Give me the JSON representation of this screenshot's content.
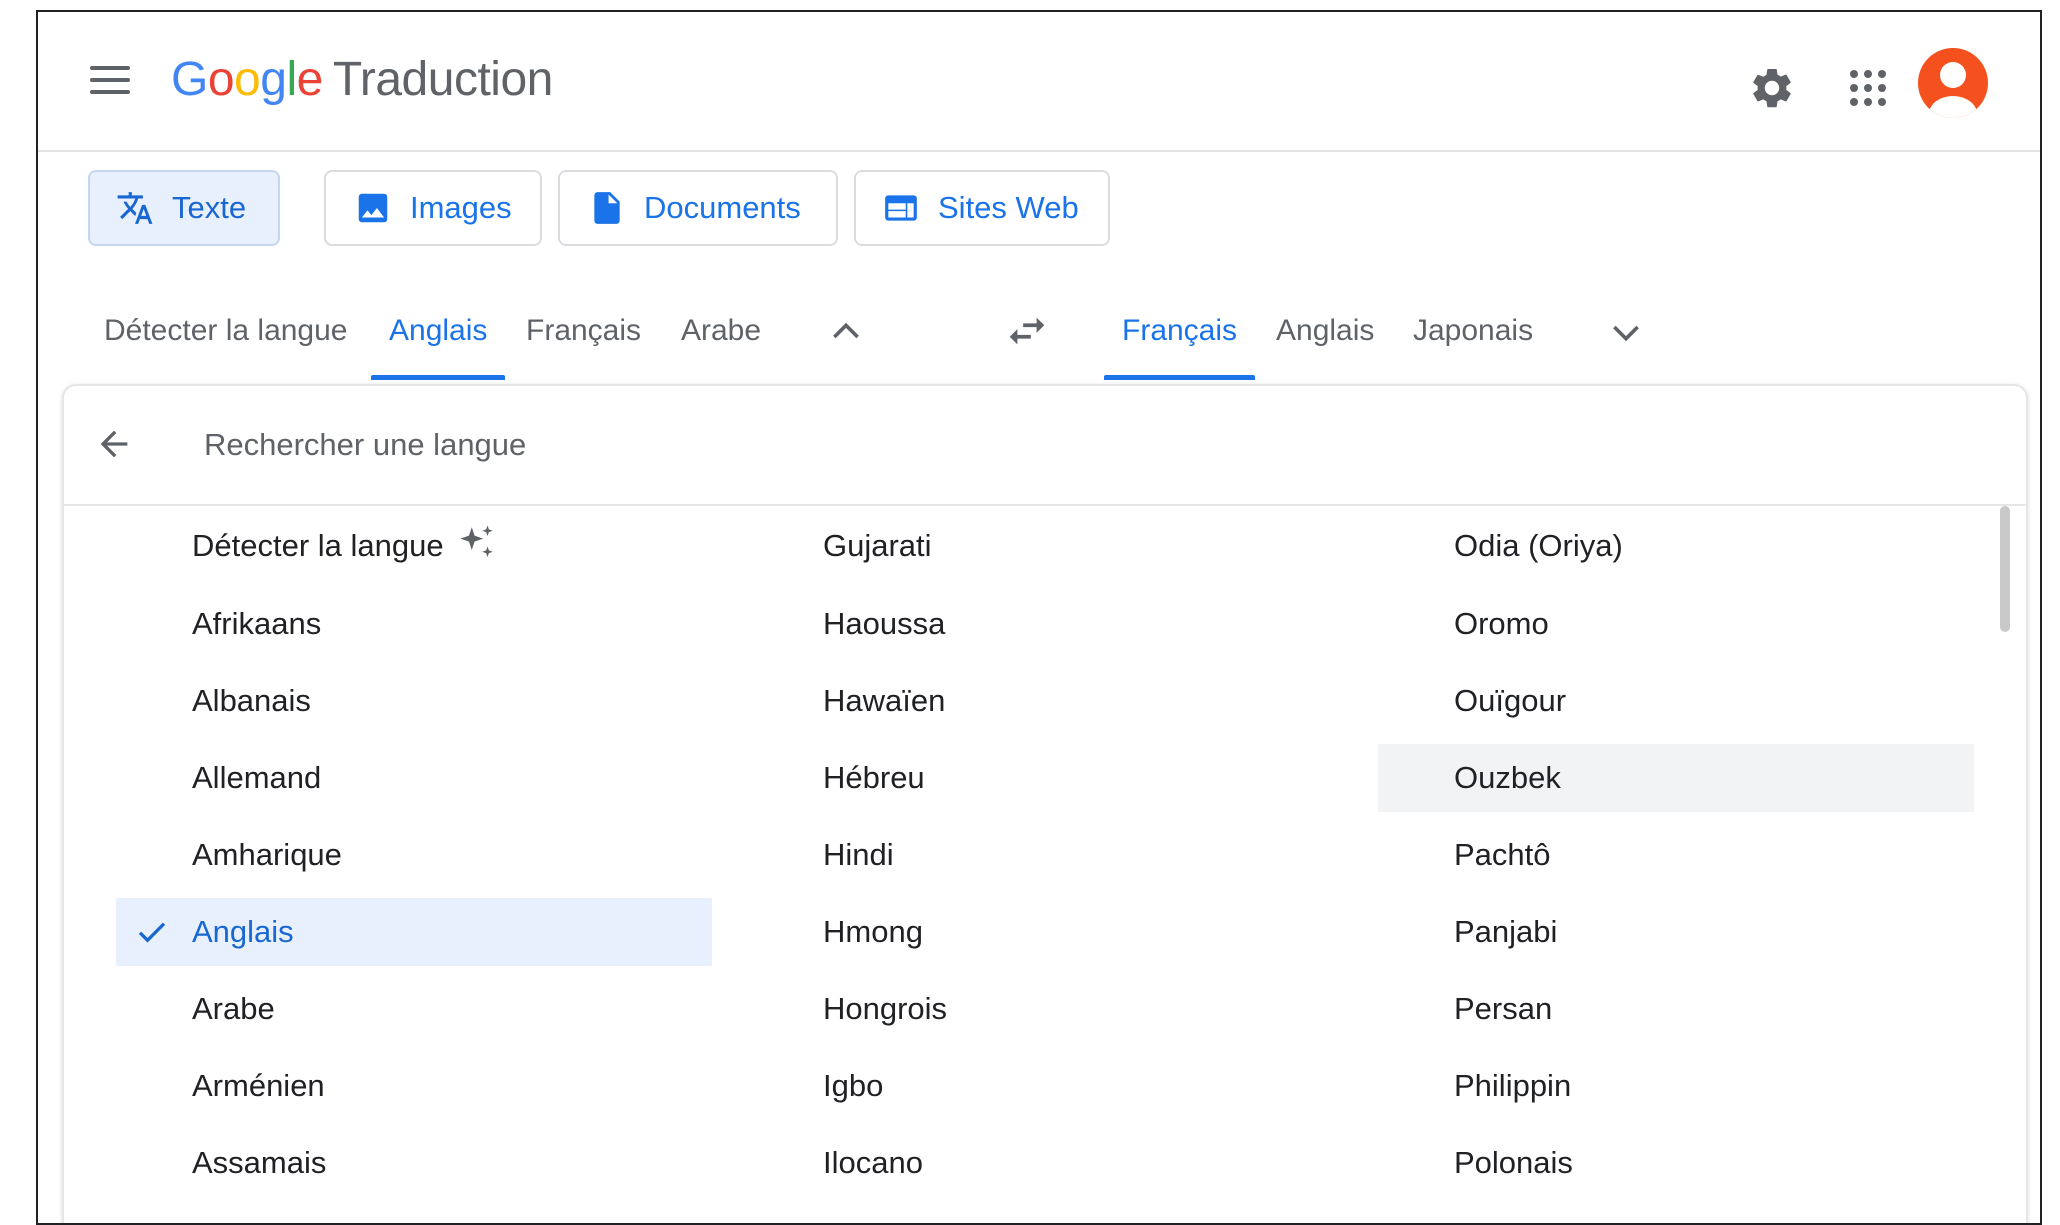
{
  "header": {
    "logo_google": "Google",
    "logo_product": "Traduction"
  },
  "colors": {
    "accent": "#1a73e8",
    "selected_bg": "#e8f0fe",
    "avatar": "#f4511e",
    "logo_blue": "#4285f4",
    "logo_red": "#ea4335",
    "logo_yellow": "#fbbc05",
    "logo_green": "#34a853"
  },
  "modes": [
    {
      "label": "Texte",
      "icon": "translate-icon"
    },
    {
      "label": "Images",
      "icon": "image-icon"
    },
    {
      "label": "Documents",
      "icon": "document-icon"
    },
    {
      "label": "Sites Web",
      "icon": "website-icon"
    }
  ],
  "source_tabs": [
    "Détecter la langue",
    "Anglais",
    "Français",
    "Arabe"
  ],
  "source_selected": "Anglais",
  "target_tabs": [
    "Français",
    "Anglais",
    "Japonais"
  ],
  "target_selected": "Français",
  "search": {
    "placeholder": "Rechercher une langue"
  },
  "languages": {
    "column1": [
      "Détecter la langue",
      "Afrikaans",
      "Albanais",
      "Allemand",
      "Amharique",
      "Anglais",
      "Arabe",
      "Arménien",
      "Assamais"
    ],
    "column2": [
      "Gujarati",
      "Haoussa",
      "Hawaïen",
      "Hébreu",
      "Hindi",
      "Hmong",
      "Hongrois",
      "Igbo",
      "Ilocano"
    ],
    "column3": [
      "Odia (Oriya)",
      "Oromo",
      "Ouïgour",
      "Ouzbek",
      "Pachtô",
      "Panjabi",
      "Persan",
      "Philippin",
      "Polonais"
    ],
    "selected": "Anglais",
    "hovered": "Ouzbek"
  }
}
